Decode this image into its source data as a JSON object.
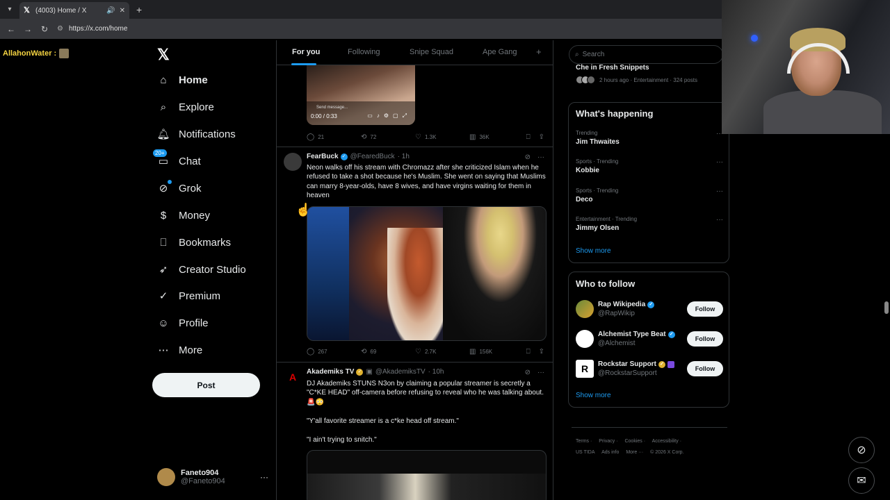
{
  "browser": {
    "tab_title": "(4003) Home / X",
    "url": "https://x.com/home"
  },
  "overlay": {
    "streamer_name": "AllahonWater :"
  },
  "sidebar": {
    "items": [
      {
        "label": "Home",
        "icon": "home-icon"
      },
      {
        "label": "Explore",
        "icon": "search-icon"
      },
      {
        "label": "Notifications",
        "icon": "bell-icon"
      },
      {
        "label": "Chat",
        "icon": "chat-icon",
        "badge": "20+"
      },
      {
        "label": "Grok",
        "icon": "grok-icon"
      },
      {
        "label": "Money",
        "icon": "money-icon"
      },
      {
        "label": "Bookmarks",
        "icon": "bookmark-icon"
      },
      {
        "label": "Creator Studio",
        "icon": "rocket-icon"
      },
      {
        "label": "Premium",
        "icon": "verified-icon"
      },
      {
        "label": "Profile",
        "icon": "person-icon"
      },
      {
        "label": "More",
        "icon": "more-circle-icon"
      }
    ],
    "post_label": "Post",
    "account": {
      "name": "Faneto904",
      "handle": "@Faneto904"
    }
  },
  "feed": {
    "tabs": [
      "For you",
      "Following",
      "Snipe Squad",
      "Ape Gang"
    ],
    "video1": {
      "time": "0:00 / 0:33",
      "send": "Send message..."
    },
    "post0_actions": {
      "replies": "21",
      "reposts": "72",
      "likes": "1.3K",
      "views": "36K"
    },
    "posts": [
      {
        "name": "FearBuck",
        "handle": "@FearedBuck",
        "time": "· 1h",
        "text": "Neon walks off his stream with Chromazz after she criticized Islam when he refused to take a shot because he's Muslim. She went on saying that Muslims can marry 8-year-olds, have 8 wives, and have virgins waiting for them in heaven",
        "replies": "267",
        "reposts": "69",
        "likes": "2.7K",
        "views": "156K"
      },
      {
        "name": "Akademiks TV",
        "handle": "@AkademiksTV",
        "time": "· 10h",
        "text1": "DJ Akademiks STUNS N3on by claiming a popular streamer is secretly a \"C*KE HEAD\" off-camera before refusing to reveal who he was talking about. 🚨😳",
        "text2": "\"Y'all favorite streamer is a c*ke head off stream.\"",
        "text3": "\"I ain't trying to snitch.\""
      }
    ]
  },
  "right": {
    "search_placeholder": "Search",
    "top_trend": {
      "title": "Che in Fresh Snippets",
      "meta": "2 hours ago · Entertainment · 324 posts"
    },
    "whats_happening": {
      "title": "What's happening",
      "trends": [
        {
          "category": "Trending",
          "name": "Jim Thwaites"
        },
        {
          "category": "Sports · Trending",
          "name": "Kobbie"
        },
        {
          "category": "Sports · Trending",
          "name": "Deco"
        },
        {
          "category": "Entertainment · Trending",
          "name": "Jimmy Olsen"
        }
      ],
      "show_more": "Show more"
    },
    "who_to_follow": {
      "title": "Who to follow",
      "accounts": [
        {
          "name": "Rap Wikipedia",
          "handle": "@RapWikip"
        },
        {
          "name": "Alchemist Type Beat",
          "handle": "@Alchemist"
        },
        {
          "name": "Rockstar Support",
          "handle": "@RockstarSupport"
        }
      ],
      "follow_label": "Follow",
      "show_more": "Show more"
    },
    "footer": {
      "line1": [
        "Terms ·",
        "Privacy ·",
        "Cookies ·",
        "Accessibility ·"
      ],
      "line2": [
        "US TIDA",
        "Ads info",
        "More ···",
        "© 2026 X Corp."
      ]
    }
  },
  "colors": {
    "accent": "#1d9bf0",
    "background": "#000000",
    "border": "#2f3336",
    "muted": "#71767b"
  }
}
